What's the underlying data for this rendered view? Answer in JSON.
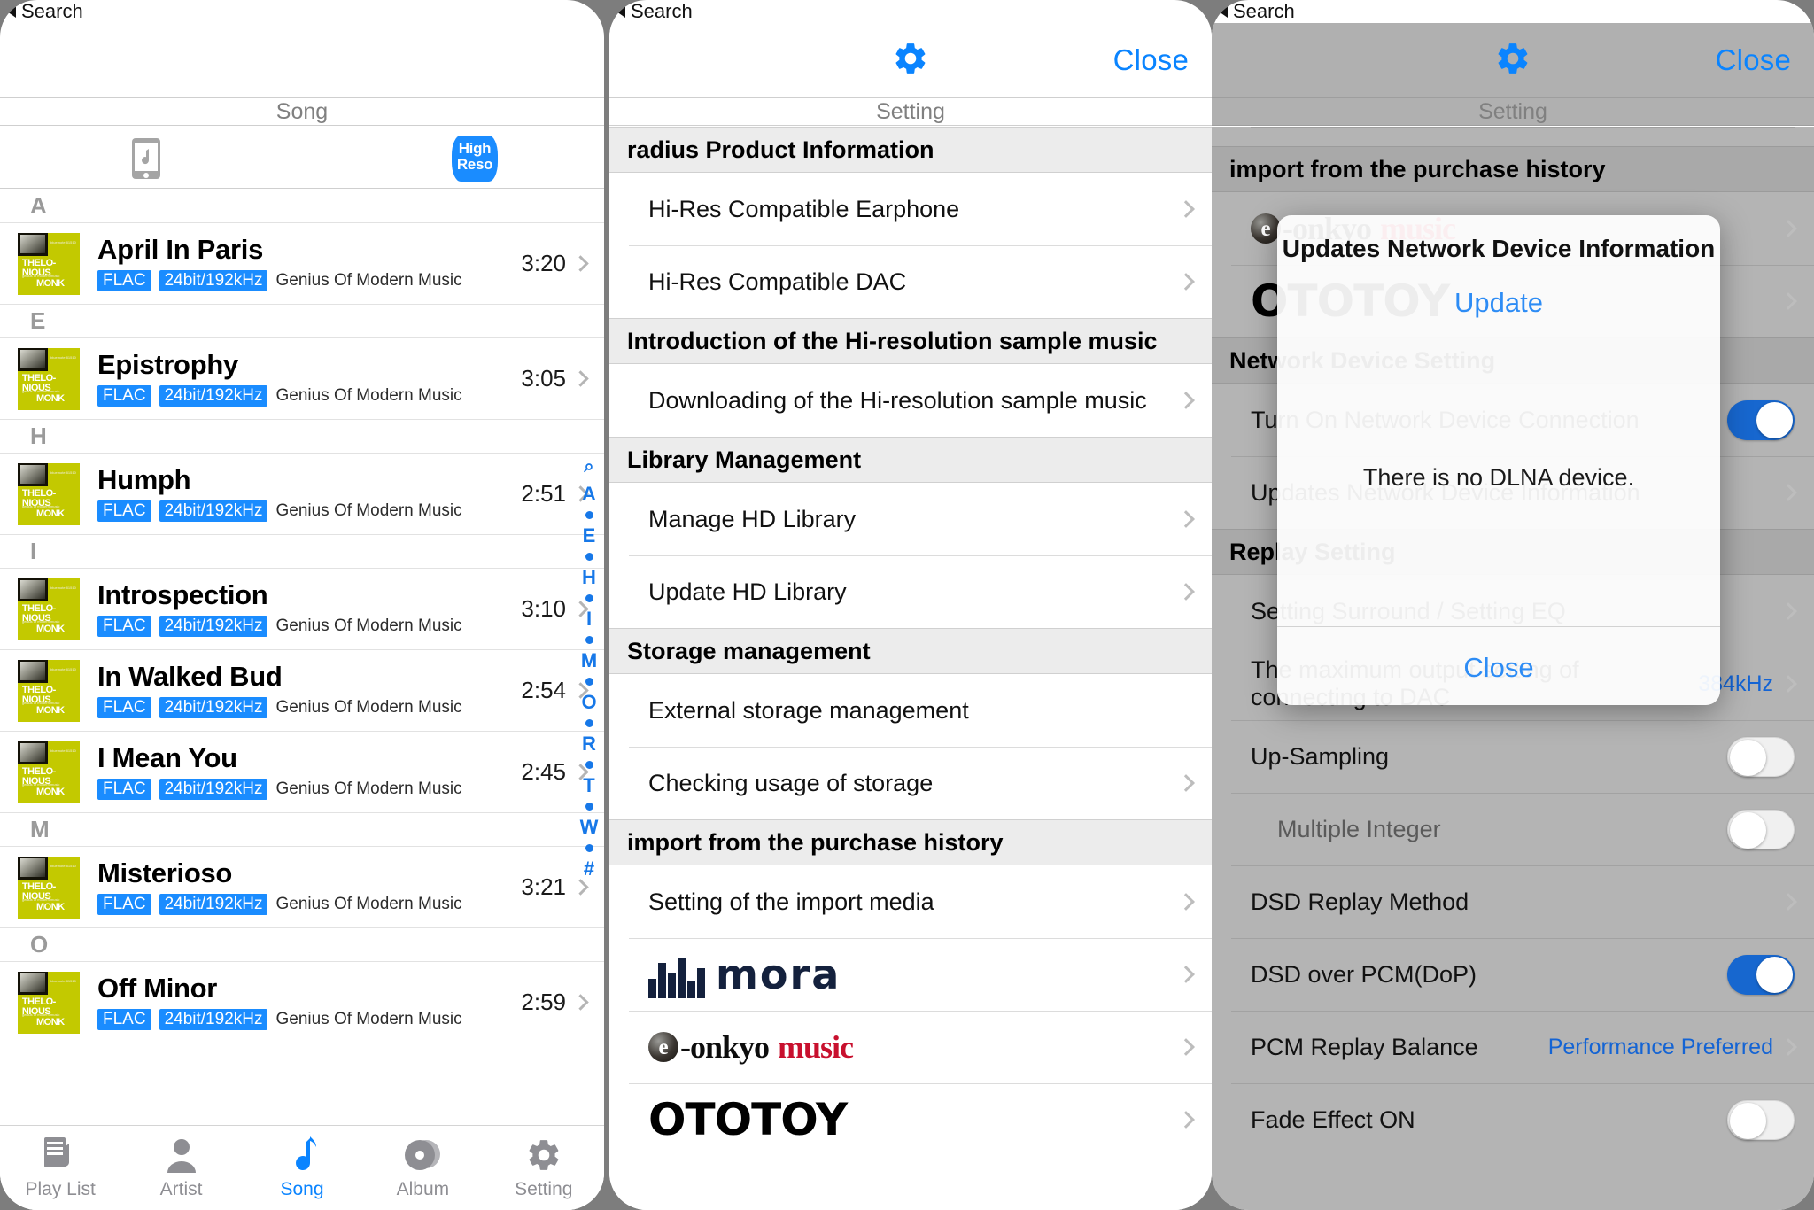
{
  "back_label": "Search",
  "nav": {
    "close_label": "Close",
    "gear_icon": "gear-icon"
  },
  "left": {
    "subtitle": "Song",
    "hires_badge": {
      "line1": "High",
      "line2": "Reso"
    },
    "device_icon": "phone-music-icon",
    "sections": [
      {
        "letter": "A",
        "songs": [
          {
            "title": "April In Paris",
            "codec": "FLAC",
            "quality": "24bit/192kHz",
            "album": "Genius Of Modern Music",
            "duration": "3:20"
          }
        ]
      },
      {
        "letter": "E",
        "songs": [
          {
            "title": "Epistrophy",
            "codec": "FLAC",
            "quality": "24bit/192kHz",
            "album": "Genius Of Modern Music",
            "duration": "3:05"
          }
        ]
      },
      {
        "letter": "H",
        "songs": [
          {
            "title": "Humph",
            "codec": "FLAC",
            "quality": "24bit/192kHz",
            "album": "Genius Of Modern Music",
            "duration": "2:51"
          }
        ]
      },
      {
        "letter": "I",
        "songs": [
          {
            "title": "Introspection",
            "codec": "FLAC",
            "quality": "24bit/192kHz",
            "album": "Genius Of Modern Music",
            "duration": "3:10"
          },
          {
            "title": "In Walked Bud",
            "codec": "FLAC",
            "quality": "24bit/192kHz",
            "album": "Genius Of Modern Music",
            "duration": "2:54"
          },
          {
            "title": "I Mean You",
            "codec": "FLAC",
            "quality": "24bit/192kHz",
            "album": "Genius Of Modern Music",
            "duration": "2:45"
          }
        ]
      },
      {
        "letter": "M",
        "songs": [
          {
            "title": "Misterioso",
            "codec": "FLAC",
            "quality": "24bit/192kHz",
            "album": "Genius Of Modern Music",
            "duration": "3:21"
          }
        ]
      },
      {
        "letter": "O",
        "songs": [
          {
            "title": "Off Minor",
            "codec": "FLAC",
            "quality": "24bit/192kHz",
            "album": "Genius Of Modern Music",
            "duration": "2:59"
          }
        ]
      }
    ],
    "album_art": {
      "line1": "THELO-",
      "line2": "NIOUS",
      "line3": "MONK",
      "sub": "genius of modern music",
      "corner": "blue note 81510"
    },
    "index_strip": [
      "Q",
      "A",
      "•",
      "E",
      "•",
      "H",
      "•",
      "I",
      "•",
      "M",
      "•",
      "O",
      "•",
      "R",
      "•",
      "T",
      "•",
      "W",
      "•",
      "#"
    ],
    "tabs": [
      {
        "label": "Play List",
        "icon": "playlist-icon",
        "active": false
      },
      {
        "label": "Artist",
        "icon": "artist-icon",
        "active": false
      },
      {
        "label": "Song",
        "icon": "music-note-icon",
        "active": true
      },
      {
        "label": "Album",
        "icon": "album-disc-icon",
        "active": false
      },
      {
        "label": "Setting",
        "icon": "gear-icon",
        "active": false
      }
    ]
  },
  "mid": {
    "subtitle": "Setting",
    "groups": [
      {
        "header": "radius Product Information",
        "rows": [
          {
            "label": "Hi-Res Compatible Earphone",
            "chevron": true
          },
          {
            "label": "Hi-Res Compatible DAC",
            "chevron": true
          }
        ]
      },
      {
        "header": "Introduction of the Hi-resolution sample music",
        "rows": [
          {
            "label": "Downloading of the Hi-resolution sample music",
            "chevron": true
          }
        ]
      },
      {
        "header": "Library Management",
        "rows": [
          {
            "label": "Manage HD Library",
            "chevron": true
          },
          {
            "label": "Update HD Library",
            "chevron": true
          }
        ]
      },
      {
        "header": "Storage management",
        "rows": [
          {
            "label": "External storage management",
            "chevron": false
          },
          {
            "label": "Checking usage of storage",
            "chevron": true
          }
        ]
      },
      {
        "header": "import from the purchase history",
        "rows": [
          {
            "label": "Setting of the import media",
            "chevron": true
          },
          {
            "label": "mora",
            "logo": "mora-logo",
            "chevron": true
          },
          {
            "label": "e-onkyo music",
            "logo": "eonkyo-logo",
            "chevron": true
          },
          {
            "label": "OTOTOY",
            "logo": "ototoy-logo",
            "chevron": true
          }
        ]
      }
    ]
  },
  "right": {
    "subtitle": "Setting",
    "groups": [
      {
        "header": "import from the purchase history",
        "rows": [
          {
            "label": "e-onkyo music",
            "logo": "eonkyo-logo",
            "chevron": true
          },
          {
            "label": "OTOTOY",
            "logo": "ototoy-logo",
            "chevron": true
          }
        ]
      },
      {
        "header": "Network Device Setting",
        "rows": [
          {
            "label": "Turn On Network Device Connection",
            "toggle": "on"
          },
          {
            "label": "Updates Network Device Information",
            "chevron": true
          }
        ]
      },
      {
        "header": "Replay Setting",
        "rows": [
          {
            "label": "Setting Surround / Setting EQ",
            "chevron": true
          },
          {
            "label": "The maximum output setting of connecting to DAC",
            "value": "384kHz",
            "chevron": true
          },
          {
            "label": "Up-Sampling",
            "toggle": "off"
          },
          {
            "label": "Multiple Integer",
            "toggle": "off",
            "indent": true
          },
          {
            "label": "DSD Replay Method",
            "chevron": true
          },
          {
            "label": "DSD over PCM(DoP)",
            "toggle": "on"
          },
          {
            "label": "PCM Replay Balance",
            "value": "Performance Preferred",
            "chevron": true
          },
          {
            "label": "Fade Effect ON",
            "toggle": "off"
          }
        ]
      }
    ],
    "modal": {
      "title": "Updates Network Device Information",
      "action_label": "Update",
      "message": "There is no DLNA device.",
      "close_label": "Close"
    }
  },
  "colors": {
    "accent_blue": "#0a84ff",
    "tag_blue": "#1a8cff",
    "group_header_bg": "#ececec",
    "album_art": "#c3c900",
    "toggle_on": "#1767cf",
    "dim_overlay": "#6e6e6e"
  }
}
